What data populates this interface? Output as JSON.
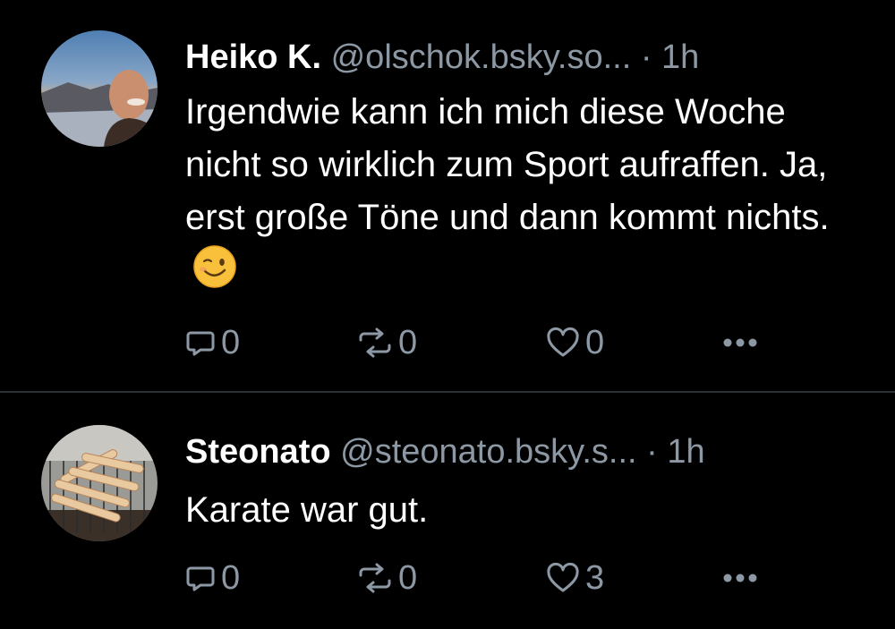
{
  "colors": {
    "background": "#000000",
    "text": "#ffffff",
    "muted": "#8d98a5",
    "divider": "#2b2f36"
  },
  "icons": {
    "reply": "speech-bubble-icon",
    "repost": "repost-arrows-icon",
    "like": "heart-outline-icon",
    "more": "ellipsis-icon",
    "emoji": "winking-face-emoji"
  },
  "posts": [
    {
      "author_name": "Heiko K.",
      "handle": "@olschok.bsky.so...",
      "separator": "·",
      "time": "1h",
      "text": "Irgendwie kann ich mich diese Woche nicht so wirklich zum Sport aufraffen. Ja, erst große Töne und dann kommt nichts.",
      "reply_count": "0",
      "repost_count": "0",
      "like_count": "0"
    },
    {
      "author_name": "Steonato",
      "handle": "@steonato.bsky.s...",
      "separator": "·",
      "time": "1h",
      "text": "Karate war gut.",
      "reply_count": "0",
      "repost_count": "0",
      "like_count": "3"
    }
  ]
}
